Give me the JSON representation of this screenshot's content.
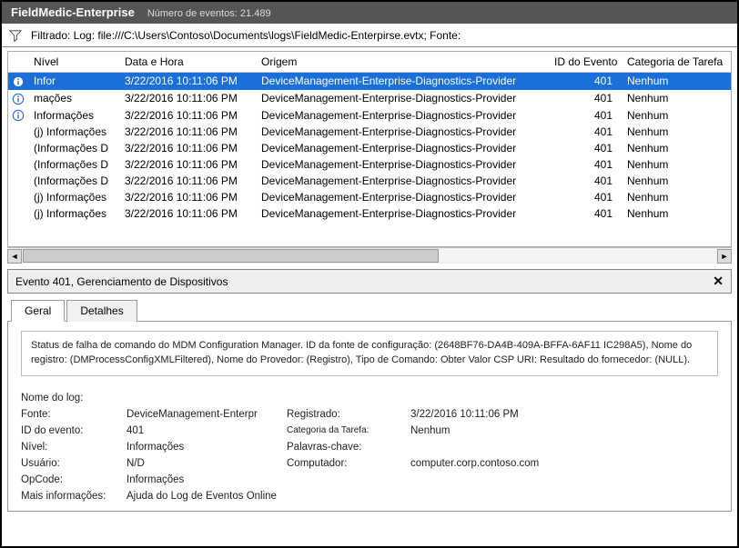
{
  "title": "FieldMedic-Enterprise",
  "event_count_label": "Número de eventos: 21.489",
  "filter_text": "Filtrado: Log:  file:///C:\\Users\\Contoso\\Documents\\logs\\FieldMedic-Enterpirse.evtx; Fonte:",
  "columns": {
    "level": "Nível",
    "datetime": "Data e Hora",
    "origin": "Origem",
    "event_id": "ID do Evento",
    "task_cat": "Categoria de Tarefa"
  },
  "rows": [
    {
      "icon": true,
      "level": "Infor",
      "dt": "3/22/2016 10:11:06 PM",
      "origin": "DeviceManagement-Enterprise-Diagnostics-Provider",
      "id": "401",
      "cat": "Nenhum",
      "sel": true
    },
    {
      "icon": true,
      "level": "mações",
      "dt": "3/22/2016 10:11:06 PM",
      "origin": "DeviceManagement-Enterprise-Diagnostics-Provider",
      "id": "401",
      "cat": "Nenhum"
    },
    {
      "icon": true,
      "level": "Informações",
      "dt": "3/22/2016 10:11:06 PM",
      "origin": "DeviceManagement-Enterprise-Diagnostics-Provider",
      "id": "401",
      "cat": "Nenhum"
    },
    {
      "icon": false,
      "level": "(j) Informações",
      "dt": "3/22/2016 10:11:06 PM",
      "origin": "DeviceManagement-Enterprise-Diagnostics-Provider",
      "id": "401",
      "cat": "Nenhum"
    },
    {
      "icon": false,
      "level": "(Informações D",
      "dt": "3/22/2016 10:11:06 PM",
      "origin": "DeviceManagement-Enterprise-Diagnostics-Provider",
      "id": "401",
      "cat": "Nenhum"
    },
    {
      "icon": false,
      "level": "(Informações D",
      "dt": "3/22/2016 10:11:06 PM",
      "origin": "DeviceManagement-Enterprise-Diagnostics-Provider",
      "id": "401",
      "cat": "Nenhum"
    },
    {
      "icon": false,
      "level": "(Informações D",
      "dt": "3/22/2016 10:11:06 PM",
      "origin": "DeviceManagement-Enterprise-Diagnostics-Provider",
      "id": "401",
      "cat": "Nenhum"
    },
    {
      "icon": false,
      "level": "(j) Informações",
      "dt": "3/22/2016 10:11:06 PM",
      "origin": "DeviceManagement-Enterprise-Diagnostics-Provider",
      "id": "401",
      "cat": "Nenhum"
    },
    {
      "icon": false,
      "level": "(j) Informações",
      "dt": "3/22/2016 10:11:06 PM",
      "origin": "DeviceManagement-Enterprise-Diagnostics-Provider",
      "id": "401",
      "cat": "Nenhum"
    }
  ],
  "detail_title": "Evento 401, Gerenciamento de Dispositivos",
  "tabs": {
    "general": "Geral",
    "details": "Detalhes"
  },
  "status_text": "Status de falha de comando do MDM Configuration Manager. ID da fonte de configuração: (2648BF76-DA4B-409A-BFFA-6AF11 IC298A5), Nome do registro: (DMProcessConfigXMLFiltered), Nome do Provedor: (Registro), Tipo de Comando: Obter Valor CSP URI: Resultado do fornecedor: (NULL).",
  "kv": {
    "log_name_lbl": "Nome do log:",
    "log_name_val": "",
    "source_lbl": "Fonte:",
    "source_val": "DeviceManagement-Enterpr",
    "registered_lbl": "Registrado:",
    "registered_val": "3/22/2016 10:11:06 PM",
    "eventid_lbl": "ID do evento:",
    "eventid_val": "401",
    "taskcat_lbl": "Categoria da Tarefa:",
    "taskcat_val": "Nenhum",
    "level_lbl": "Nível:",
    "level_val": "Informações",
    "keywords_lbl": "Palavras-chave:",
    "keywords_val": "",
    "user_lbl": "Usuário:",
    "user_val": "N/D",
    "computer_lbl": "Computador:",
    "computer_val": "computer.corp.contoso.com",
    "opcode_lbl": "OpCode:",
    "opcode_val": "Informações",
    "moreinfo_lbl": "Mais informações:",
    "moreinfo_val": "Ajuda do Log de Eventos Online"
  }
}
